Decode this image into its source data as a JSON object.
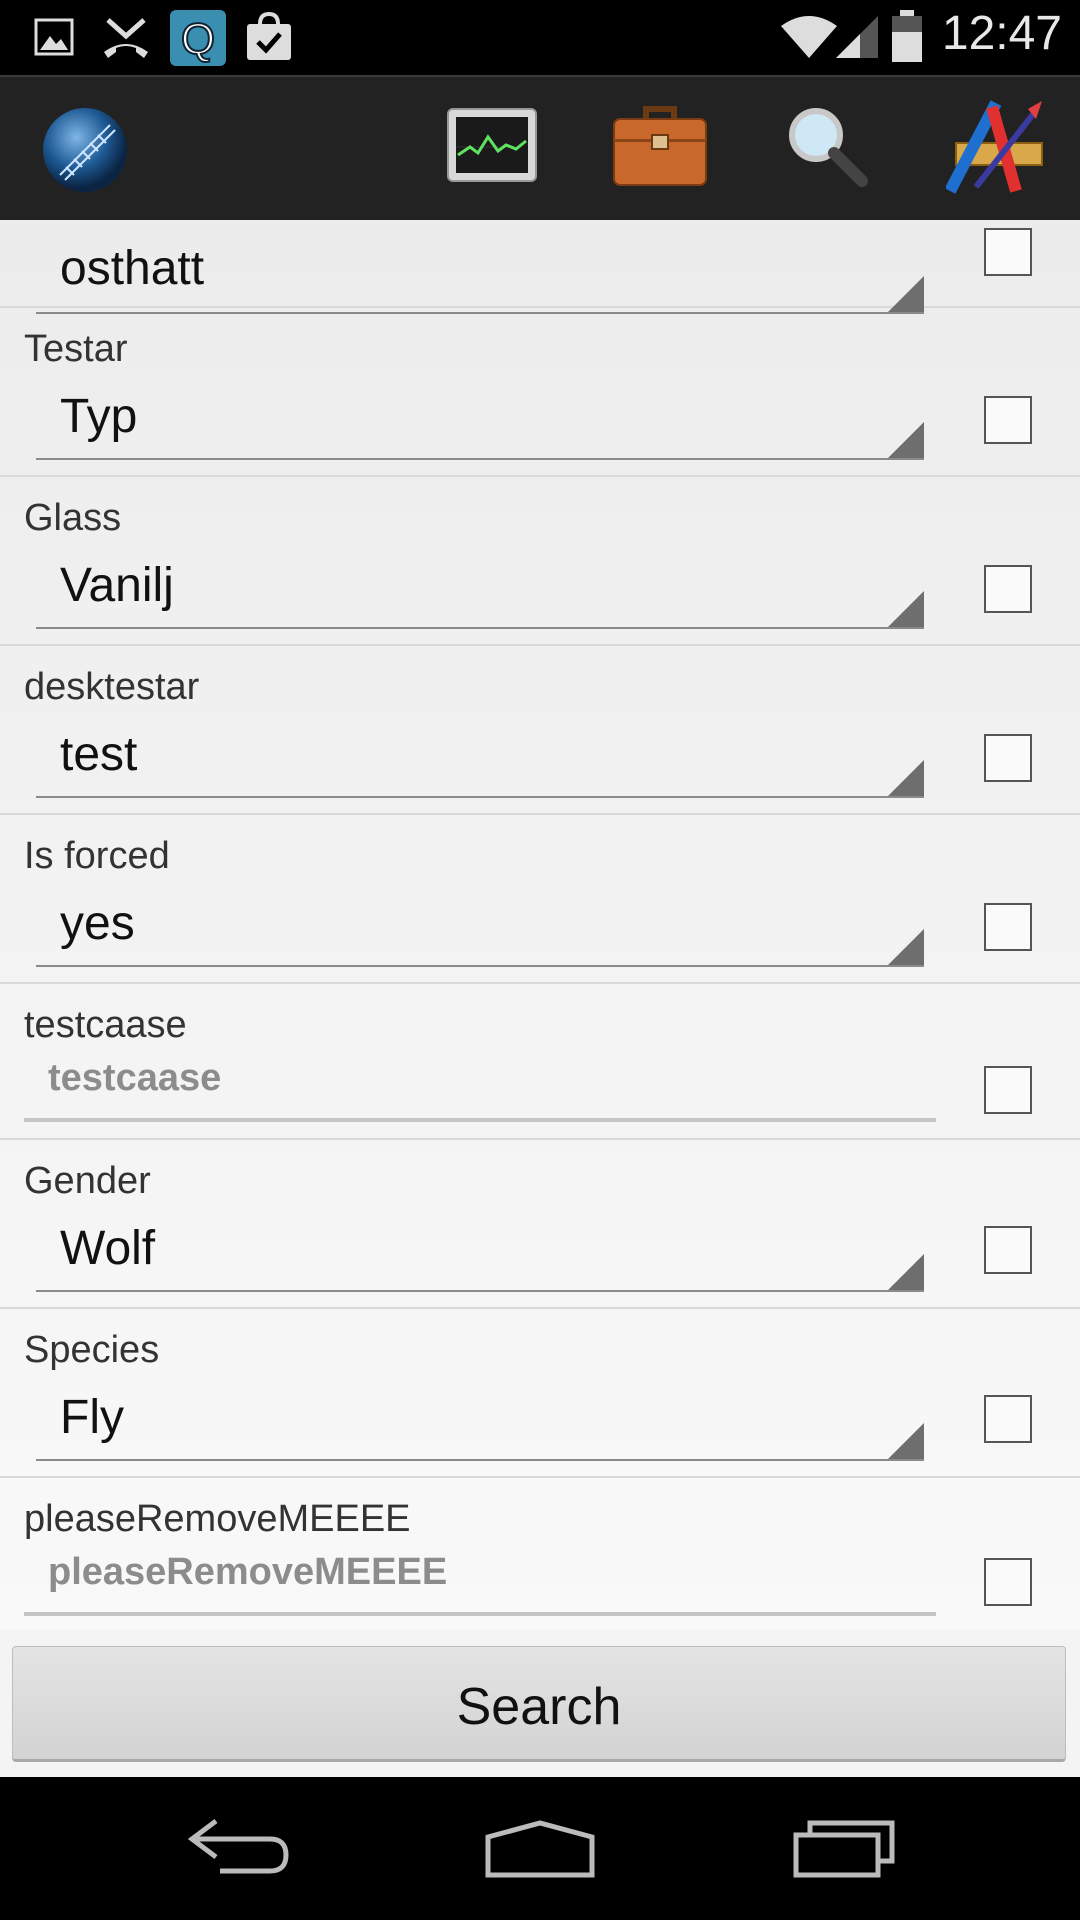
{
  "status": {
    "time": "12:47"
  },
  "form": {
    "first_row_value": "osthatt",
    "rows": [
      {
        "label": "Testar",
        "value": "Typ"
      },
      {
        "label": "Glass",
        "value": "Vanilj"
      },
      {
        "label": "desktestar",
        "value": "test"
      },
      {
        "label": "Is forced",
        "value": "yes"
      },
      {
        "label": "testcaase",
        "placeholder": "testcaase"
      },
      {
        "label": "Gender",
        "value": "Wolf"
      },
      {
        "label": "Species",
        "value": "Fly"
      },
      {
        "label": "pleaseRemoveMEEEE",
        "placeholder": "pleaseRemoveMEEEE"
      }
    ]
  },
  "search_label": "Search"
}
